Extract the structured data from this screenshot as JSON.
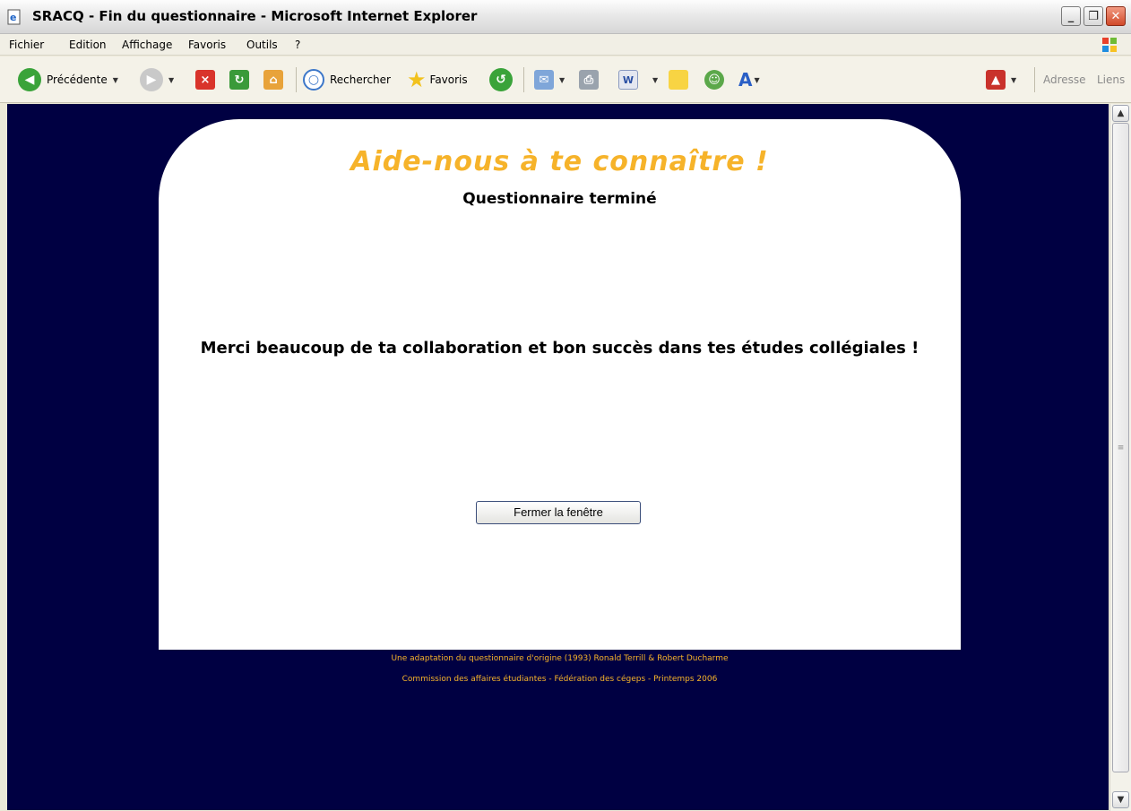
{
  "window": {
    "title": "SRACQ - Fin du questionnaire - Microsoft Internet Explorer",
    "controls": {
      "minimize": "_",
      "restore": "❐",
      "close": "✕"
    }
  },
  "menu": [
    "Fichier",
    "Edition",
    "Affichage",
    "Favoris",
    "Outils",
    "?"
  ],
  "toolbar": {
    "back_label": "Précédente",
    "search_label": "Rechercher",
    "favorites_label": "Favoris",
    "address_label": "Adresse",
    "links_label": "Liens"
  },
  "page": {
    "headline": "Aide-nous à te connaître !",
    "subtitle": "Questionnaire terminé",
    "thanks": "Merci beaucoup de ta collaboration et bon succès dans tes études collégiales !",
    "close_button": "Fermer la fenêtre",
    "footer_line1": "Une adaptation du questionnaire d'origine (1993) Ronald Terrill & Robert Ducharme",
    "footer_line2": "Commission des affaires étudiantes - Fédération des cégeps - Printemps 2006"
  },
  "colors": {
    "background": "#000042",
    "accent": "#f6b32a",
    "card": "#ffffff"
  },
  "icons": [
    "ie-page-icon",
    "windows-flag-icon",
    "back-arrow-icon",
    "forward-arrow-icon",
    "stop-icon",
    "refresh-icon",
    "home-icon",
    "search-icon",
    "favorites-star-icon",
    "history-icon",
    "mail-icon",
    "print-icon",
    "word-icon",
    "note-icon",
    "messenger-icon",
    "font-icon",
    "pdf-icon"
  ]
}
